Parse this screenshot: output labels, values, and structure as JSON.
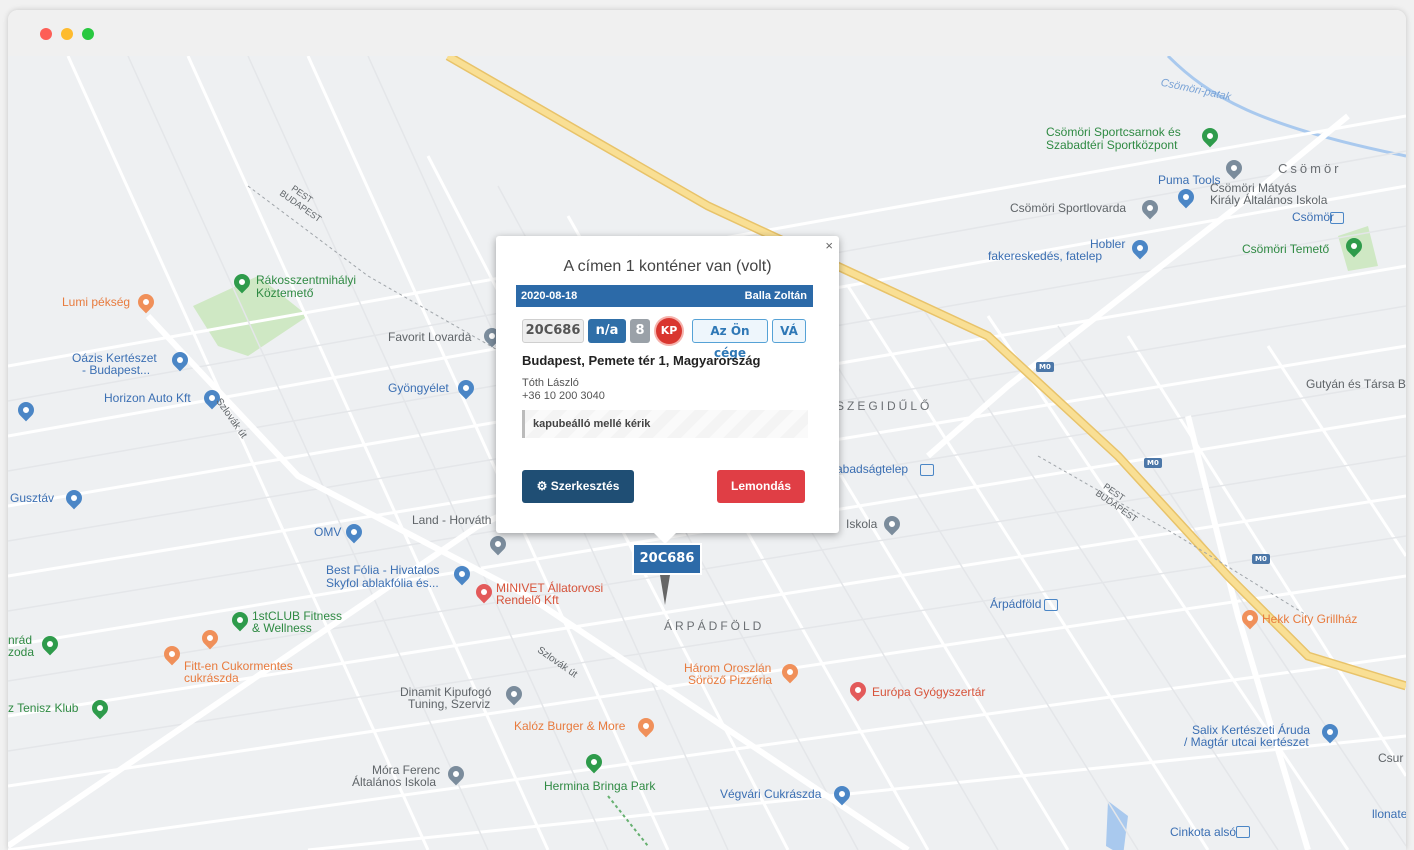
{
  "window": {
    "title": ""
  },
  "map": {
    "labels": [
      {
        "text": "Csömöri-patak",
        "cls": "water"
      },
      {
        "text": "Csömöri Sportcsarnok és",
        "cls": "green"
      },
      {
        "text": "Szabadtéri Sportközpont",
        "cls": "green"
      },
      {
        "text": "Csömör",
        "cls": "area"
      },
      {
        "text": "Puma Tools",
        "cls": "blue"
      },
      {
        "text": "Csömöri Mátyás",
        "cls": ""
      },
      {
        "text": "Király Általános Iskola",
        "cls": ""
      },
      {
        "text": "Csömöri Sportlovarda",
        "cls": ""
      },
      {
        "text": "Csömör",
        "cls": "blue"
      },
      {
        "text": "Hobler",
        "cls": "blue"
      },
      {
        "text": "fakereskedés, fatelep",
        "cls": "blue"
      },
      {
        "text": "Csömöri Temető",
        "cls": "green"
      },
      {
        "text": "Rákosszentmihályi",
        "cls": "green"
      },
      {
        "text": "Köztemető",
        "cls": "green"
      },
      {
        "text": "Lumi pékség",
        "cls": "orange"
      },
      {
        "text": "Favorit Lovarda",
        "cls": ""
      },
      {
        "text": "Oázis Kertészet",
        "cls": "blue"
      },
      {
        "text": "- Budapest...",
        "cls": "blue"
      },
      {
        "text": "Gyöngyélet",
        "cls": "blue"
      },
      {
        "text": "Horizon Auto Kft",
        "cls": "blue"
      },
      {
        "text": "Gutyán és Társa B",
        "cls": ""
      },
      {
        "text": "SZEGIDŰLŐ",
        "cls": "area"
      },
      {
        "text": "abadságtelep",
        "cls": "blue"
      },
      {
        "text": "Gusztáv",
        "cls": "blue"
      },
      {
        "text": "OMV",
        "cls": "blue"
      },
      {
        "text": "Land - Horváth",
        "cls": ""
      },
      {
        "text": "Iskola",
        "cls": ""
      },
      {
        "text": "Best Fólia - Hivatalos",
        "cls": "blue"
      },
      {
        "text": "Skyfol ablakfólia és...",
        "cls": "blue"
      },
      {
        "text": "MINIVET Állatorvosi",
        "cls": "red"
      },
      {
        "text": "Rendelő Kft",
        "cls": "red"
      },
      {
        "text": "Árpádföld",
        "cls": "blue"
      },
      {
        "text": "Hekk City Grillház",
        "cls": "orange"
      },
      {
        "text": "1stCLUB Fitness",
        "cls": "green"
      },
      {
        "text": "& Wellness",
        "cls": "green"
      },
      {
        "text": "ÁRPÁDFÖLD",
        "cls": "area"
      },
      {
        "text": "nrád",
        "cls": "green"
      },
      {
        "text": "zoda",
        "cls": "green"
      },
      {
        "text": "Fitt-en Cukormentes",
        "cls": "orange"
      },
      {
        "text": "cukrászda",
        "cls": "orange"
      },
      {
        "text": "Három Oroszlán",
        "cls": "orange"
      },
      {
        "text": "Söröző Pizzéria",
        "cls": "orange"
      },
      {
        "text": "Dinamit Kipufogó",
        "cls": ""
      },
      {
        "text": "Tuning, Szerviz",
        "cls": ""
      },
      {
        "text": "Európa Gyógyszertár",
        "cls": "red"
      },
      {
        "text": "z Tenisz Klub",
        "cls": "green"
      },
      {
        "text": "Kalóz Burger & More",
        "cls": "orange"
      },
      {
        "text": "Salix Kertészeti Áruda",
        "cls": "blue"
      },
      {
        "text": "/ Magtár utcai kertészet",
        "cls": "blue"
      },
      {
        "text": "Csur",
        "cls": ""
      },
      {
        "text": "Móra Ferenc",
        "cls": ""
      },
      {
        "text": "Általános Iskola",
        "cls": ""
      },
      {
        "text": "Hermina Bringa Park",
        "cls": "green"
      },
      {
        "text": "Végvári Cukrászda",
        "cls": "blue"
      },
      {
        "text": "Cinkota alsó",
        "cls": "blue"
      },
      {
        "text": "llonate",
        "cls": "blue"
      },
      {
        "text": "Szlovák út",
        "cls": ""
      },
      {
        "text": "PEST",
        "cls": ""
      },
      {
        "text": "BUDAPEST",
        "cls": ""
      },
      {
        "text": "M0",
        "cls": ""
      }
    ]
  },
  "popup": {
    "close": "×",
    "title": "A címen 1 konténer van (volt)",
    "date": "2020-08-18",
    "driver": "Balla Zoltán",
    "badges": {
      "id": "20C686",
      "status": "n/a",
      "count": "8",
      "kp": "KP",
      "company": "Az Ön cége",
      "va": "VÁ"
    },
    "address": "Budapest, Pemete tér 1, Magyarország",
    "contact_name": "Tóth László",
    "contact_phone": "+36 10 200 3040",
    "note": "kapubeálló mellé kérik",
    "edit_label": "Szerkesztés",
    "cancel_label": "Lemondás"
  },
  "marker": {
    "label": "20C686"
  },
  "colors": {
    "primary": "#2c6aa8",
    "edit_button": "#1f4e74",
    "cancel_button": "#e03e45",
    "kp_badge": "#d9362f",
    "highway": "#f7d67e"
  }
}
